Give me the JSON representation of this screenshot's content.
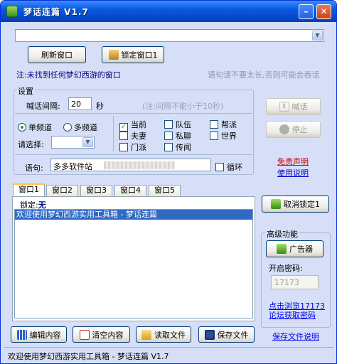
{
  "window": {
    "title": "梦话连篇 V1.7"
  },
  "top": {
    "refresh_button": "刷新窗口",
    "lock_button": "锁定窗口1",
    "note": "注:未找到任何梦幻西游的窗口",
    "warning": "语句请不要太长,否则可能会吞话"
  },
  "settings": {
    "group_label": "设置",
    "interval_label": "喊话间隔:",
    "interval_value": "20",
    "interval_unit": "秒",
    "interval_note": "(注:间隔不能小于10秒)",
    "single_channel": "单频道",
    "multi_channel": "多频道",
    "select_label": "请选择:",
    "channels": [
      {
        "label": "当前",
        "checked": true
      },
      {
        "label": "队伍",
        "checked": false
      },
      {
        "label": "帮派",
        "checked": false
      },
      {
        "label": "夫妻",
        "checked": false
      },
      {
        "label": "私聊",
        "checked": false
      },
      {
        "label": "世界",
        "checked": false
      },
      {
        "label": "门派",
        "checked": false
      },
      {
        "label": "传闻",
        "checked": false
      }
    ],
    "phrase_label": "语句:",
    "phrase_value": "多多软件站",
    "loop_label": "循环"
  },
  "right": {
    "shout_button": "喊话",
    "stop_button": "停止",
    "disclaimer_link": "免责声明",
    "usage_link": "使用说明",
    "unlock_button": "取消锁定1",
    "advanced_label": "高级功能",
    "ad_button": "广告器",
    "password_label": "开启密码:",
    "password_placeholder": "17173",
    "browse_link_1": "点击浏览17173",
    "browse_link_2": "论坛获取密码",
    "save_doc_link": "保存文件说明"
  },
  "tabs": [
    "窗口1",
    "窗口2",
    "窗口3",
    "窗口4",
    "窗口5"
  ],
  "panel": {
    "lock_label": "锁定:",
    "lock_value": "无",
    "list_items": [
      "欢迎使用梦幻西游实用工具箱 - 梦话连篇"
    ]
  },
  "bottom": {
    "edit_button": "编辑内容",
    "clear_button": "清空内容",
    "read_button": "读取文件",
    "save_button": "保存文件"
  },
  "status": "欢迎使用梦幻西游实用工具箱 - 梦话连篇 V1.7"
}
